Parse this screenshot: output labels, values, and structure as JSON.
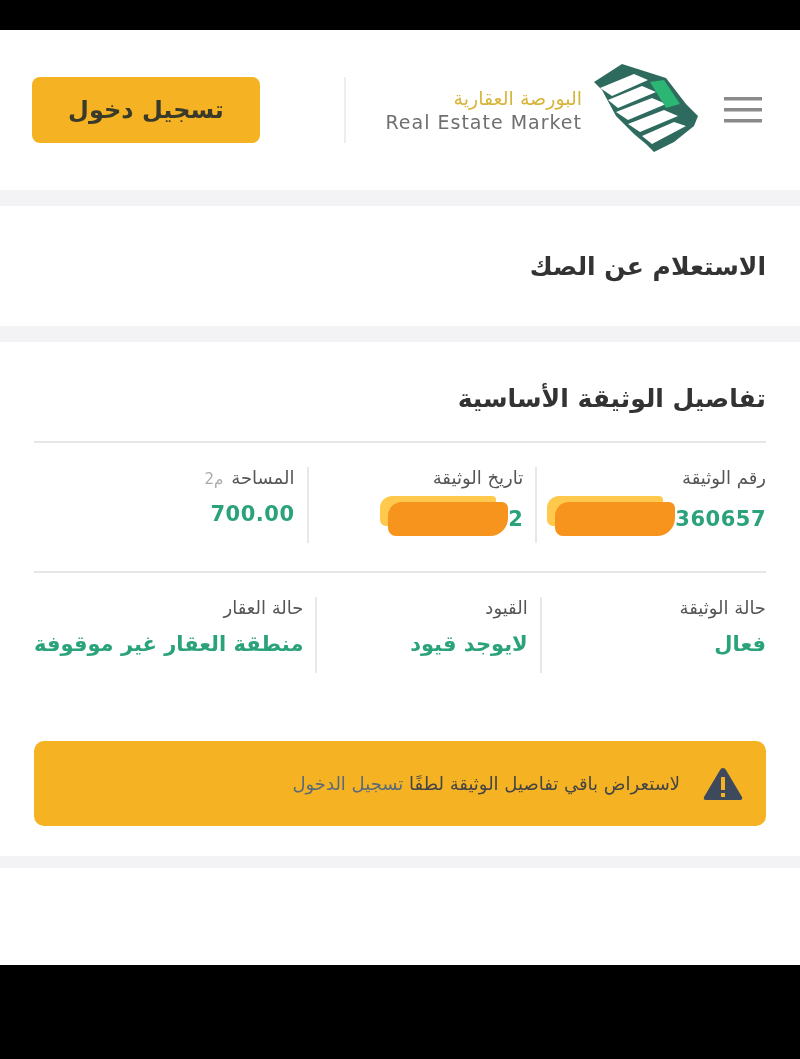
{
  "header": {
    "logo_arabic": "البورصة العقارية",
    "logo_english": "Real Estate Market",
    "login_button": "تسجيل دخول"
  },
  "inquiry": {
    "title": "الاستعلام عن الصك"
  },
  "document": {
    "title": "تفاصيل الوثيقة الأساسية",
    "fields": [
      {
        "label": "رقم الوثيقة",
        "value": "360657",
        "redacted": true
      },
      {
        "label": "تاريخ الوثيقة",
        "value": "2",
        "redacted": true
      },
      {
        "label": "المساحة",
        "unit": "م2",
        "value": "700.00",
        "redacted": false
      },
      {
        "label": "حالة الوثيقة",
        "value": "فعال",
        "redacted": false
      },
      {
        "label": "القيود",
        "value": "لايوجد قيود",
        "redacted": false
      },
      {
        "label": "حالة العقار",
        "value": "منطقة العقار غير موقوفة",
        "redacted": false
      }
    ]
  },
  "notice": {
    "text": "لاستعراض باقي تفاصيل الوثيقة لطفًا",
    "link": "تسجيل الدخول"
  }
}
